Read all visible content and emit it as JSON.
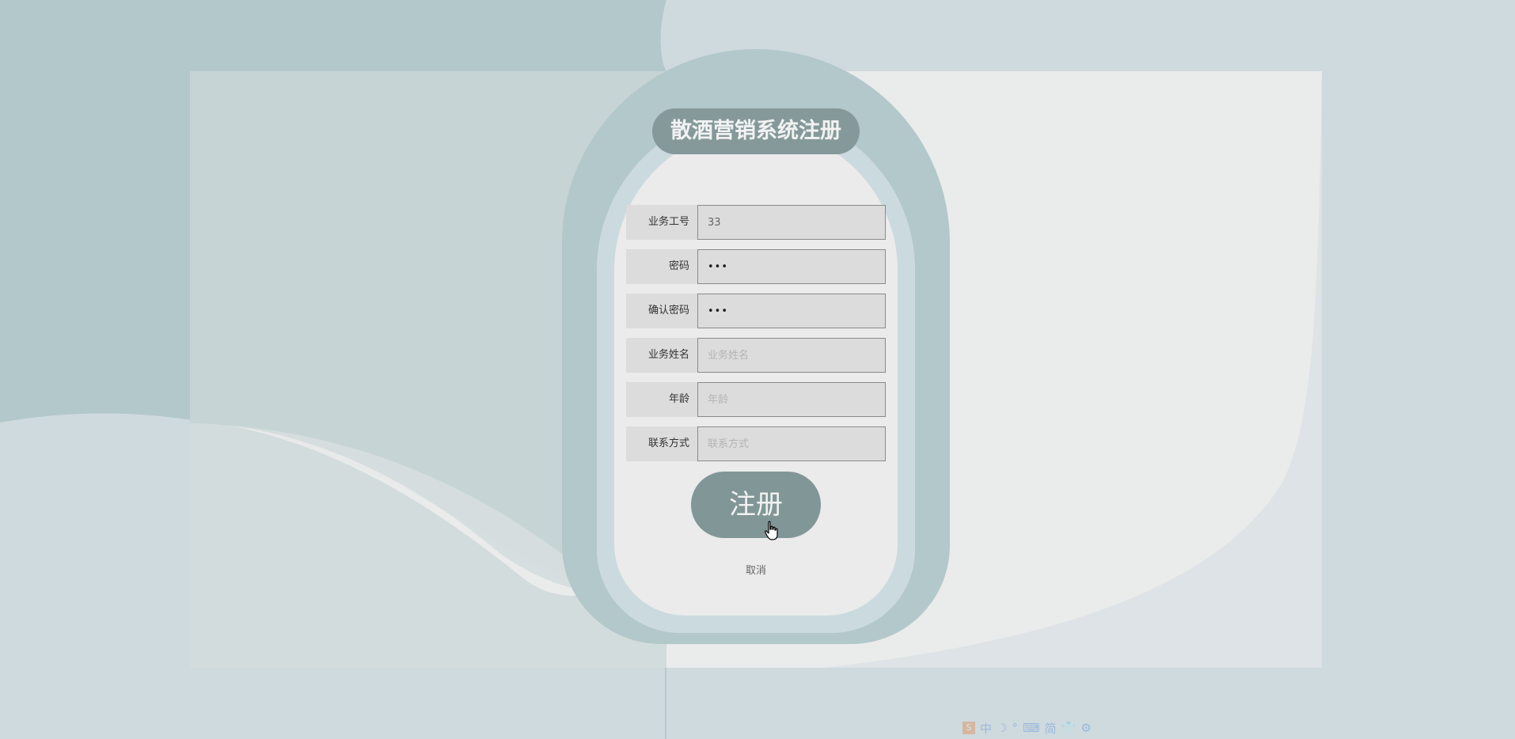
{
  "form": {
    "title": "散酒营销系统注册",
    "fields": [
      {
        "label": "业务工号",
        "value": "33",
        "placeholder": "业务工号",
        "type": "text"
      },
      {
        "label": "密码",
        "value": "•••",
        "placeholder": "密码",
        "type": "password"
      },
      {
        "label": "确认密码",
        "value": "•••",
        "placeholder": "确认密码",
        "type": "password"
      },
      {
        "label": "业务姓名",
        "value": "",
        "placeholder": "业务姓名",
        "type": "text"
      },
      {
        "label": "年龄",
        "value": "",
        "placeholder": "年龄",
        "type": "text"
      },
      {
        "label": "联系方式",
        "value": "",
        "placeholder": "联系方式",
        "type": "text"
      }
    ],
    "submit_label": "注册",
    "cancel_label": "取消"
  },
  "ime_toolbar": {
    "logo": "S",
    "mode": "中",
    "items": [
      "☽",
      "°",
      "⌨",
      "简",
      "👕",
      "⚙"
    ]
  },
  "colors": {
    "accent": "#819697",
    "background": "#cfdadf",
    "card": "#b3c8ca"
  }
}
